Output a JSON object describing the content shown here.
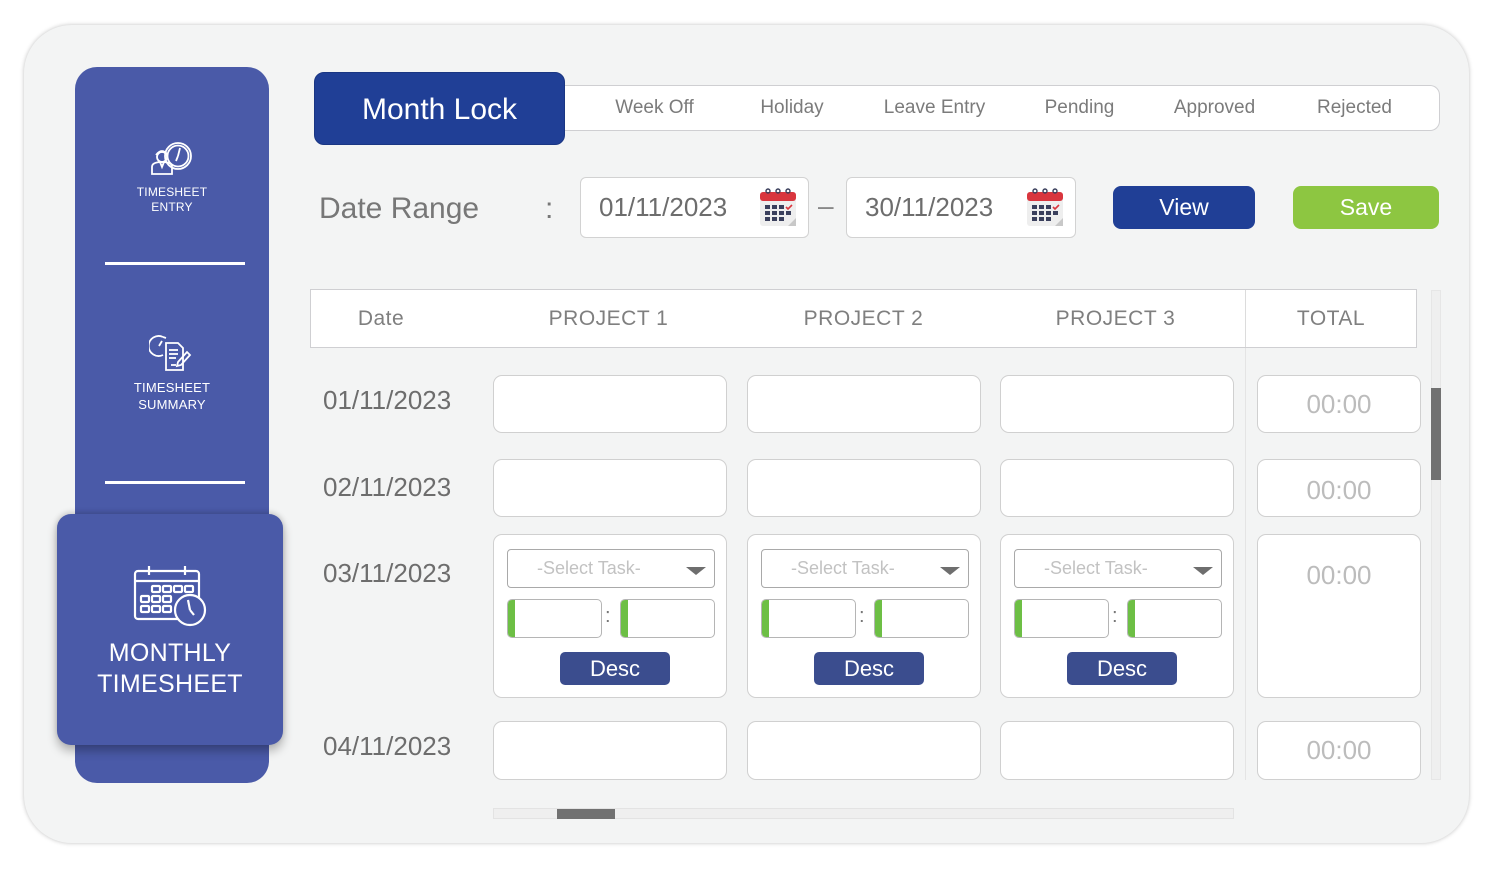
{
  "sidebar": {
    "items": [
      {
        "label_line1": "TIMESHEET",
        "label_line2": "ENTRY",
        "icon": "user-clock-icon",
        "active": false
      },
      {
        "label_line1": "TIMESHEET",
        "label_line2": "SUMMARY",
        "icon": "document-edit-clock-icon",
        "active": false
      },
      {
        "label_line1": "MONTHLY",
        "label_line2": "TIMESHEET",
        "icon": "calendar-clock-icon",
        "active": true
      }
    ]
  },
  "tabs": {
    "active": "Month Lock",
    "items": [
      "Week Off",
      "Holiday",
      "Leave Entry",
      "Pending",
      "Approved",
      "Rejected"
    ]
  },
  "date_range": {
    "label": "Date Range",
    "colon": ":",
    "separator": "–",
    "from": "01/11/2023",
    "to": "30/11/2023",
    "icon": "calendar-icon"
  },
  "actions": {
    "view_label": "View",
    "save_label": "Save",
    "view_color": "#203f96",
    "save_color": "#8dc641"
  },
  "table": {
    "headers": [
      "Date",
      "PROJECT 1",
      "PROJECT 2",
      "PROJECT 3",
      "TOTAL"
    ],
    "rows": [
      {
        "date": "01/11/2023",
        "total": "00:00",
        "expanded": false
      },
      {
        "date": "02/11/2023",
        "total": "00:00",
        "expanded": false
      },
      {
        "date": "03/11/2023",
        "total": "00:00",
        "expanded": true
      },
      {
        "date": "04/11/2023",
        "total": "00:00",
        "expanded": false
      }
    ],
    "expanded_cell": {
      "select_placeholder": "-Select Task-",
      "time_separator": ":",
      "desc_label": "Desc"
    }
  }
}
